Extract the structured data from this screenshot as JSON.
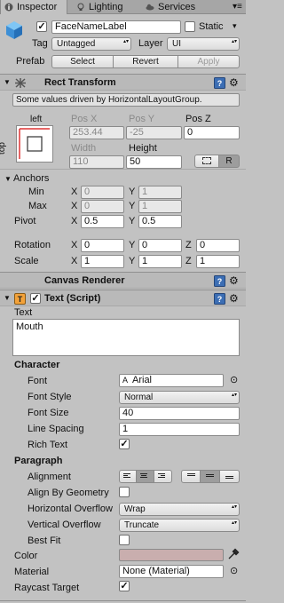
{
  "tabs": [
    {
      "label": "Inspector",
      "icon": "info-icon",
      "active": true
    },
    {
      "label": "Lighting",
      "icon": "lighting-icon",
      "active": false
    },
    {
      "label": "Services",
      "icon": "cloud-icon",
      "active": false
    }
  ],
  "object": {
    "name": "FaceNameLabel",
    "static_label": "Static",
    "tag_label": "Tag",
    "tag_value": "Untagged",
    "layer_label": "Layer",
    "layer_value": "UI",
    "prefab_label": "Prefab",
    "prefab_buttons": [
      "Select",
      "Revert",
      "Apply"
    ]
  },
  "rect_transform": {
    "title": "Rect Transform",
    "note": "Some values driven by HorizontalLayoutGroup.",
    "anchor_h": "left",
    "anchor_v": "top",
    "pos_x_label": "Pos X",
    "pos_x": "253.44",
    "pos_y_label": "Pos Y",
    "pos_y": "-25",
    "pos_z_label": "Pos Z",
    "pos_z": "0",
    "width_label": "Width",
    "width": "110",
    "height_label": "Height",
    "height": "50",
    "r_button": "R",
    "anchors_label": "Anchors",
    "min_label": "Min",
    "min_x": "0",
    "min_y": "1",
    "max_label": "Max",
    "max_x": "0",
    "max_y": "1",
    "pivot_label": "Pivot",
    "pivot_x": "0.5",
    "pivot_y": "0.5",
    "rotation_label": "Rotation",
    "rot_x": "0",
    "rot_y": "0",
    "rot_z": "0",
    "scale_label": "Scale",
    "scale_x": "1",
    "scale_y": "1",
    "scale_z": "1",
    "axis_x": "X",
    "axis_y": "Y",
    "axis_z": "Z"
  },
  "canvas_renderer": {
    "title": "Canvas Renderer"
  },
  "text_script": {
    "title": "Text (Script)",
    "text_label": "Text",
    "text_value": "Mouth",
    "character_label": "Character",
    "font_label": "Font",
    "font_value": "Arial",
    "font_style_label": "Font Style",
    "font_style_value": "Normal",
    "font_size_label": "Font Size",
    "font_size_value": "40",
    "line_spacing_label": "Line Spacing",
    "line_spacing_value": "1",
    "rich_text_label": "Rich Text",
    "rich_text": true,
    "paragraph_label": "Paragraph",
    "alignment_label": "Alignment",
    "align_by_geometry_label": "Align By Geometry",
    "align_by_geometry": false,
    "horizontal_overflow_label": "Horizontal Overflow",
    "horizontal_overflow_value": "Wrap",
    "vertical_overflow_label": "Vertical Overflow",
    "vertical_overflow_value": "Truncate",
    "best_fit_label": "Best Fit",
    "best_fit": false,
    "color_label": "Color",
    "color_value": "#c9aeae",
    "material_label": "Material",
    "material_value": "None (Material)",
    "raycast_label": "Raycast Target",
    "raycast": true
  }
}
